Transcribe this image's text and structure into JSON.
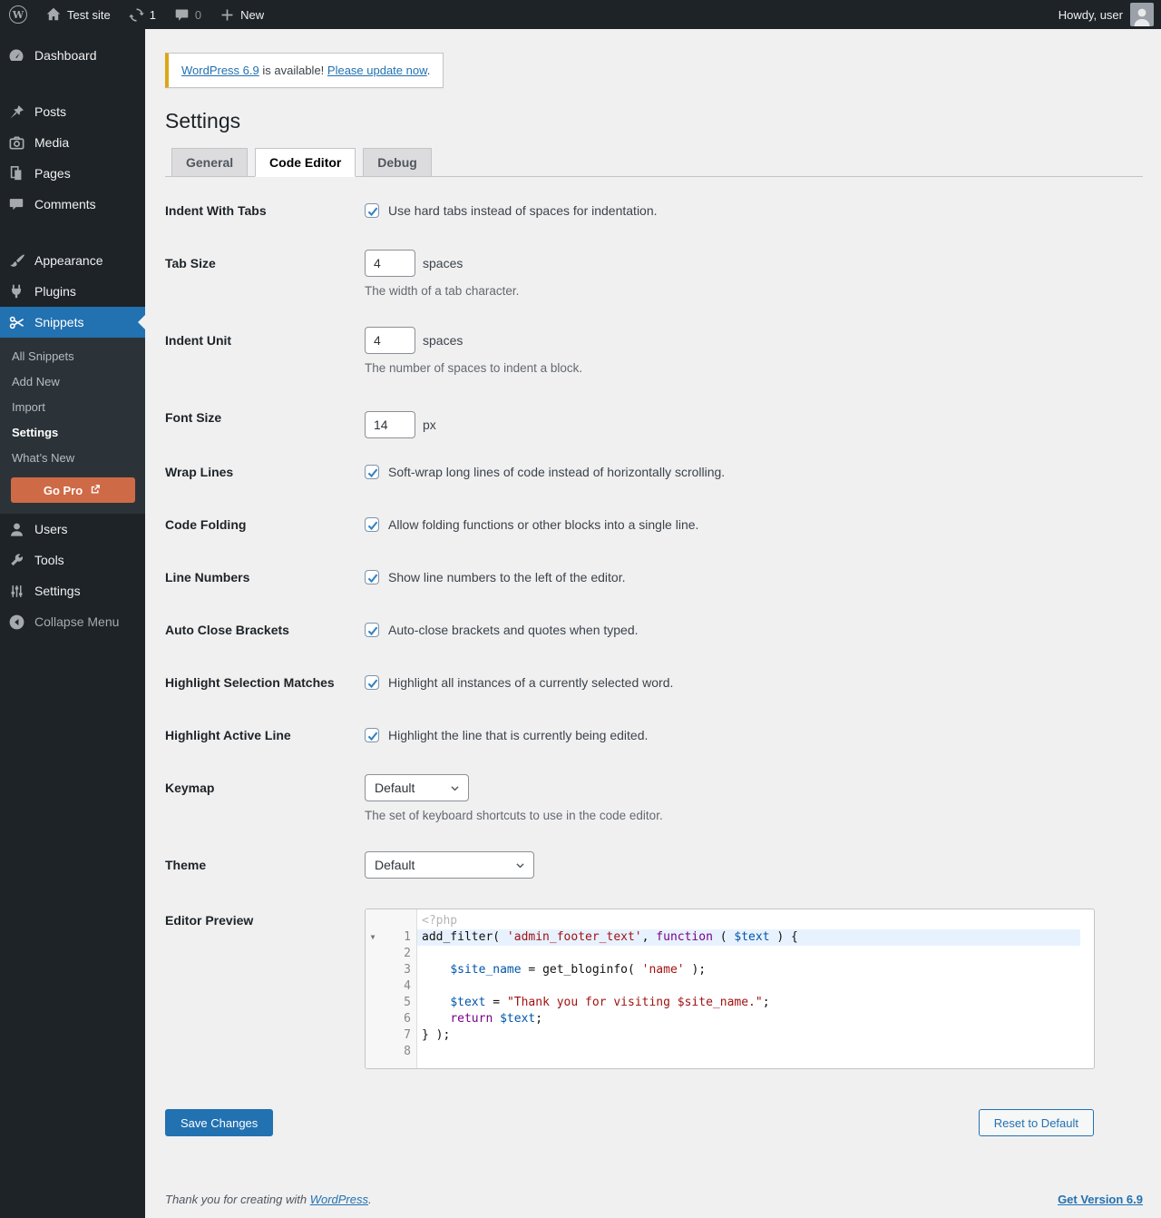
{
  "admin_bar": {
    "site_name": "Test site",
    "update_count": "1",
    "comment_count": "0",
    "new_label": "New",
    "howdy": "Howdy, user"
  },
  "sidebar": {
    "dashboard": "Dashboard",
    "posts": "Posts",
    "media": "Media",
    "pages": "Pages",
    "comments": "Comments",
    "appearance": "Appearance",
    "plugins": "Plugins",
    "snippets": "Snippets",
    "users": "Users",
    "tools": "Tools",
    "settings": "Settings",
    "collapse": "Collapse Menu",
    "submenu": {
      "all_snippets": "All Snippets",
      "add_new": "Add New",
      "import": "Import",
      "settings": "Settings",
      "whats_new": "What’s New",
      "go_pro": "Go Pro"
    }
  },
  "notice": {
    "version_link": "WordPress 6.9",
    "middle": " is available! ",
    "update_link": "Please update now",
    "period": "."
  },
  "page": {
    "title": "Settings"
  },
  "tabs": {
    "general": "General",
    "code_editor": "Code Editor",
    "debug": "Debug"
  },
  "form": {
    "indent_with_tabs": {
      "label": "Indent With Tabs",
      "text": "Use hard tabs instead of spaces for indentation.",
      "checked": "true"
    },
    "tab_size": {
      "label": "Tab Size",
      "value": "4",
      "unit": "spaces",
      "desc": "The width of a tab character."
    },
    "indent_unit": {
      "label": "Indent Unit",
      "value": "4",
      "unit": "spaces",
      "desc": "The number of spaces to indent a block."
    },
    "font_size": {
      "label": "Font Size",
      "value": "14",
      "unit": "px"
    },
    "wrap_lines": {
      "label": "Wrap Lines",
      "text": "Soft-wrap long lines of code instead of horizontally scrolling.",
      "checked": "true"
    },
    "code_folding": {
      "label": "Code Folding",
      "text": "Allow folding functions or other blocks into a single line.",
      "checked": "true"
    },
    "line_numbers": {
      "label": "Line Numbers",
      "text": "Show line numbers to the left of the editor.",
      "checked": "true"
    },
    "auto_close_brackets": {
      "label": "Auto Close Brackets",
      "text": "Auto-close brackets and quotes when typed.",
      "checked": "true"
    },
    "highlight_selection_matches": {
      "label": "Highlight Selection Matches",
      "text": "Highlight all instances of a currently selected word.",
      "checked": "true"
    },
    "highlight_active_line": {
      "label": "Highlight Active Line",
      "text": "Highlight the line that is currently being edited.",
      "checked": "true"
    },
    "keymap": {
      "label": "Keymap",
      "value": "Default",
      "desc": "The set of keyboard shortcuts to use in the code editor."
    },
    "theme": {
      "label": "Theme",
      "value": "Default"
    },
    "editor_preview_label": "Editor Preview"
  },
  "editor": {
    "php_tag": "<?php",
    "fold_marker": "▼",
    "line_numbers": [
      "1",
      "2",
      "3",
      "4",
      "5",
      "6",
      "7",
      "8"
    ],
    "lines": [
      [
        {
          "c": "p",
          "s": "add_filter( "
        },
        {
          "c": "s",
          "s": "'admin_footer_text'"
        },
        {
          "c": "p",
          "s": ", "
        },
        {
          "c": "k",
          "s": "function"
        },
        {
          "c": "p",
          "s": " ( "
        },
        {
          "c": "v",
          "s": "$text"
        },
        {
          "c": "p",
          "s": " ) {"
        }
      ],
      [],
      [
        {
          "c": "p",
          "s": "    "
        },
        {
          "c": "v",
          "s": "$site_name"
        },
        {
          "c": "p",
          "s": " = get_bloginfo( "
        },
        {
          "c": "s",
          "s": "'name'"
        },
        {
          "c": "p",
          "s": " );"
        }
      ],
      [],
      [
        {
          "c": "p",
          "s": "    "
        },
        {
          "c": "v",
          "s": "$text"
        },
        {
          "c": "p",
          "s": " = "
        },
        {
          "c": "s",
          "s": "\"Thank you for visiting $site_name.\""
        },
        {
          "c": "p",
          "s": ";"
        }
      ],
      [
        {
          "c": "p",
          "s": "    "
        },
        {
          "c": "k",
          "s": "return"
        },
        {
          "c": "p",
          "s": " "
        },
        {
          "c": "v",
          "s": "$text"
        },
        {
          "c": "p",
          "s": ";"
        }
      ],
      [
        {
          "c": "p",
          "s": "} );"
        }
      ],
      []
    ]
  },
  "buttons": {
    "save": "Save Changes",
    "reset": "Reset to Default"
  },
  "footer": {
    "thanks_prefix": "Thank you for creating with ",
    "wp_link": "WordPress",
    "period": ".",
    "version_link": "Get Version 6.9"
  },
  "colors": {
    "accent": "#2271b1",
    "admin_dark": "#1d2327",
    "submenu_bg": "#2c3338",
    "page_bg": "#f0f0f1",
    "notice_accent": "#dba617",
    "go_pro_bg": "#cf6a47",
    "active_line_bg": "#e8f2ff",
    "code_string": "#a11111",
    "code_keyword": "#770088",
    "code_variable": "#0055aa"
  }
}
